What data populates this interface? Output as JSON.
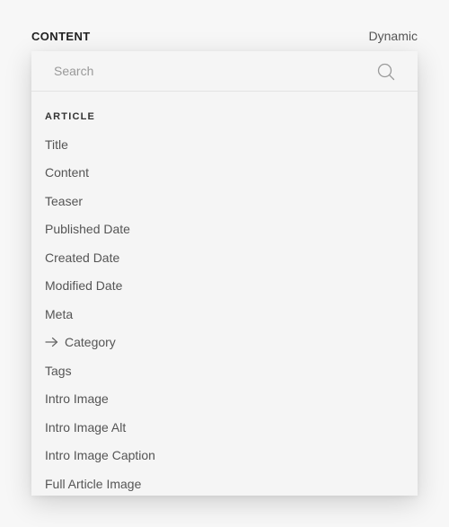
{
  "header": {
    "title": "CONTENT",
    "mode": "Dynamic"
  },
  "search": {
    "placeholder": "Search",
    "value": ""
  },
  "section": {
    "label": "ARTICLE"
  },
  "items": [
    {
      "label": "Title",
      "icon": null
    },
    {
      "label": "Content",
      "icon": null
    },
    {
      "label": "Teaser",
      "icon": null
    },
    {
      "label": "Published Date",
      "icon": null
    },
    {
      "label": "Created Date",
      "icon": null
    },
    {
      "label": "Modified Date",
      "icon": null
    },
    {
      "label": "Meta",
      "icon": null
    },
    {
      "label": "Category",
      "icon": "arrow-right-icon"
    },
    {
      "label": "Tags",
      "icon": null
    },
    {
      "label": "Intro Image",
      "icon": null
    },
    {
      "label": "Intro Image Alt",
      "icon": null
    },
    {
      "label": "Intro Image Caption",
      "icon": null
    },
    {
      "label": "Full Article Image",
      "icon": null
    }
  ],
  "colors": {
    "background": "#f7f7f7",
    "panel": "#f5f5f5",
    "text": "#555555",
    "heading": "#222222"
  }
}
